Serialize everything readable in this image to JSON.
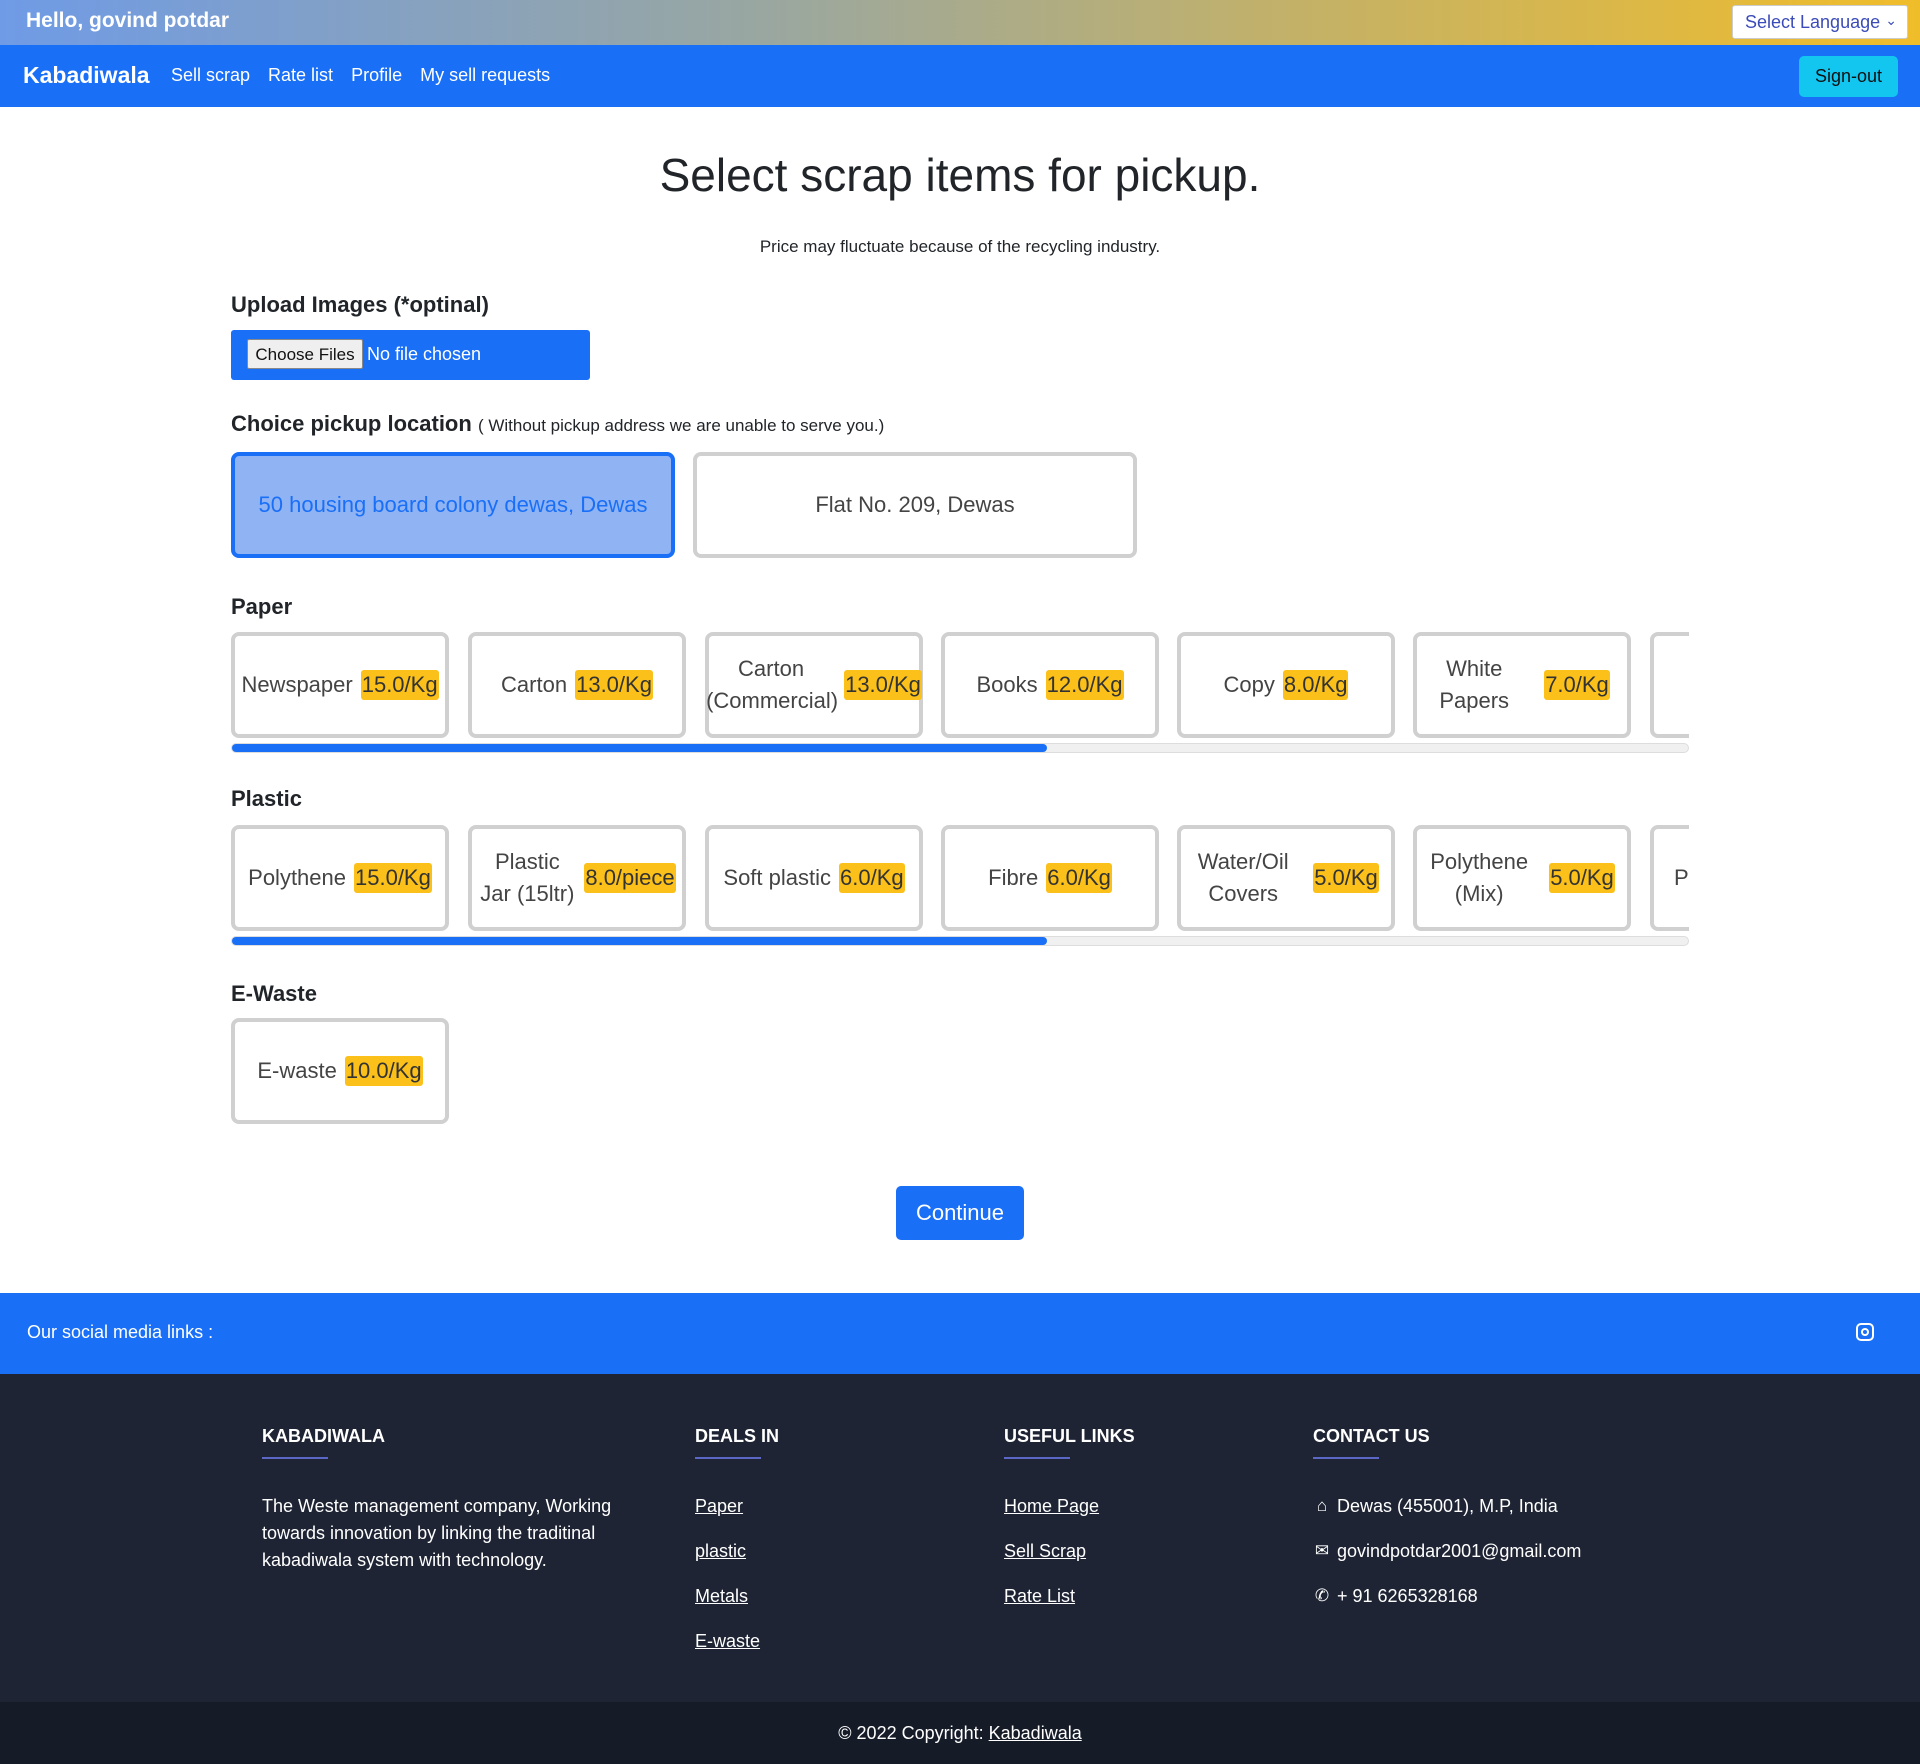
{
  "topbar": {
    "greeting": "Hello, govind potdar",
    "language_label": "Select Language"
  },
  "navbar": {
    "brand": "Kabadiwala",
    "links": [
      "Sell scrap",
      "Rate list",
      "Profile",
      "My sell requests"
    ],
    "signout": "Sign-out"
  },
  "page": {
    "title": "Select scrap items for pickup.",
    "note": "Price may fluctuate because of the recycling industry.",
    "upload_label": "Upload Images (*optinal)",
    "upload_button": "Choose Files",
    "upload_status": "No file chosen",
    "location_label": "Choice pickup location",
    "location_hint": "( Without pickup address we are unable to serve you.)",
    "locations": [
      "50 housing board colony dewas, Dewas",
      "Flat No. 209, Dewas"
    ],
    "selected_location": 0,
    "continue": "Continue"
  },
  "categories": [
    {
      "name": "Paper",
      "scroll_fraction": 0.56,
      "items": [
        {
          "name": "Newspaper",
          "price": "15.0/Kg"
        },
        {
          "name": "Carton",
          "price": "13.0/Kg"
        },
        {
          "name": "Carton (Commercial)",
          "price": "13.0/Kg"
        },
        {
          "name": "Books",
          "price": "12.0/Kg"
        },
        {
          "name": "Copy",
          "price": "8.0/Kg"
        },
        {
          "name": "White Papers",
          "price": "7.0/Kg"
        }
      ]
    },
    {
      "name": "Plastic",
      "scroll_fraction": 0.56,
      "items": [
        {
          "name": "Polythene",
          "price": "15.0/Kg"
        },
        {
          "name": "Plastic Jar (15ltr)",
          "price": "8.0/piece"
        },
        {
          "name": "Soft plastic",
          "price": "6.0/Kg"
        },
        {
          "name": "Fibre",
          "price": "6.0/Kg"
        },
        {
          "name": "Water/Oil Covers",
          "price": "5.0/Kg"
        },
        {
          "name": "Polythene (Mix)",
          "price": "5.0/Kg"
        },
        {
          "name": "P",
          "price": ""
        }
      ]
    },
    {
      "name": "E-Waste",
      "items": [
        {
          "name": "E-waste",
          "price": "10.0/Kg"
        }
      ]
    }
  ],
  "social": {
    "label": "Our social media links :",
    "icon": "instagram-icon"
  },
  "footer": {
    "about_title": "KABADIWALA",
    "about_text": "The Weste management company, Working towards innovation by linking the traditinal kabadiwala system with technology.",
    "deals_title": "DEALS IN",
    "deals": [
      "Paper",
      "plastic",
      "Metals",
      "E-waste"
    ],
    "useful_title": "USEFUL LINKS",
    "useful": [
      "Home Page",
      "Sell Scrap",
      "Rate List"
    ],
    "contact_title": "CONTACT US",
    "address": "Dewas (455001), M.P, India",
    "email": "govindpotdar2001@gmail.com",
    "phone": "+ 91 6265328168"
  },
  "copyright": {
    "text": "© 2022 Copyright: ",
    "link": "Kabadiwala"
  },
  "colors": {
    "primary": "#1a6ff7",
    "price_badge": "#fbc11a",
    "footer_bg": "#1e2434",
    "signout": "#12c6f0"
  }
}
